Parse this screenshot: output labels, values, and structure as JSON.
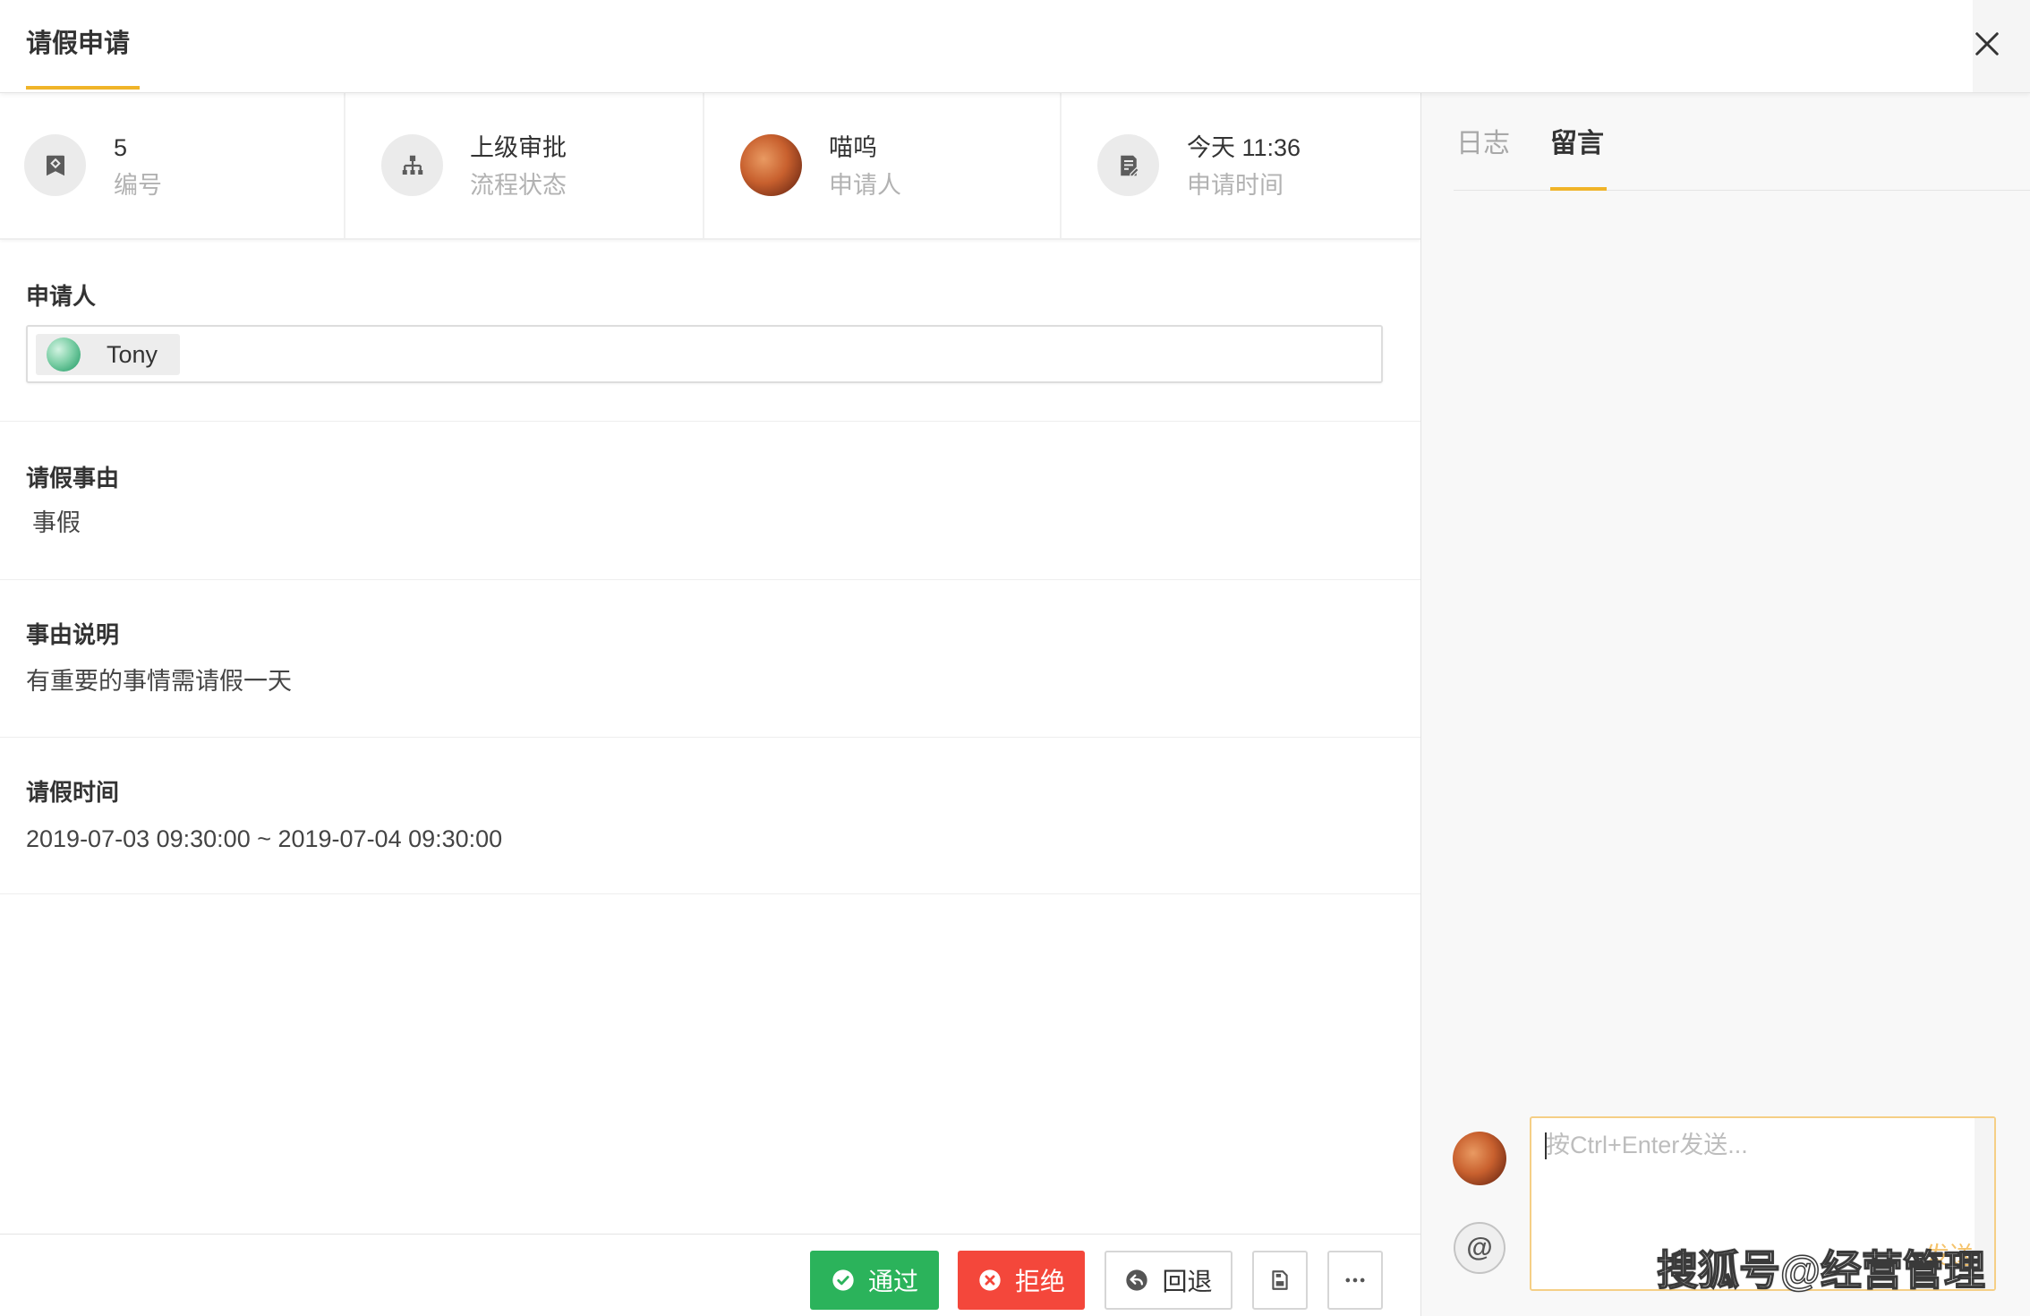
{
  "header": {
    "title": "请假申请",
    "close_icon": "close-icon"
  },
  "info_cards": [
    {
      "value": "5",
      "label": "编号",
      "icon": "tag-icon"
    },
    {
      "value": "上级审批",
      "label": "流程状态",
      "icon": "org-chart-icon"
    },
    {
      "value": "喵呜",
      "label": "申请人",
      "icon": "avatar"
    },
    {
      "value": "今天 11:36",
      "label": "申请时间",
      "icon": "document-edit-icon"
    }
  ],
  "fields": {
    "applicant": {
      "label": "申请人",
      "value": "Tony",
      "icon": "avatar"
    },
    "reason": {
      "label": "请假事由",
      "value": "事假"
    },
    "description": {
      "label": "事由说明",
      "value": "有重要的事情需请假一天"
    },
    "period": {
      "label": "请假时间",
      "value": "2019-07-03 09:30:00 ~ 2019-07-04 09:30:00"
    }
  },
  "actions": {
    "approve": {
      "label": "通过",
      "icon": "check-circle-icon"
    },
    "reject": {
      "label": "拒绝",
      "icon": "x-circle-icon"
    },
    "return": {
      "label": "回退",
      "icon": "reply-icon"
    },
    "save": {
      "icon": "save-icon"
    },
    "more": {
      "icon": "more-icon"
    }
  },
  "side_panel": {
    "tabs": [
      {
        "label": "日志",
        "active": false
      },
      {
        "label": "留言",
        "active": true
      }
    ],
    "comment": {
      "placeholder": "按Ctrl+Enter发送...",
      "mention": "@",
      "send_label": "发送"
    }
  },
  "watermark": "搜狐号@经营管理",
  "colors": {
    "accent": "#f0b429",
    "approve": "#2bb35b",
    "reject": "#f4473b",
    "panel_background": "#f8f8f8"
  }
}
